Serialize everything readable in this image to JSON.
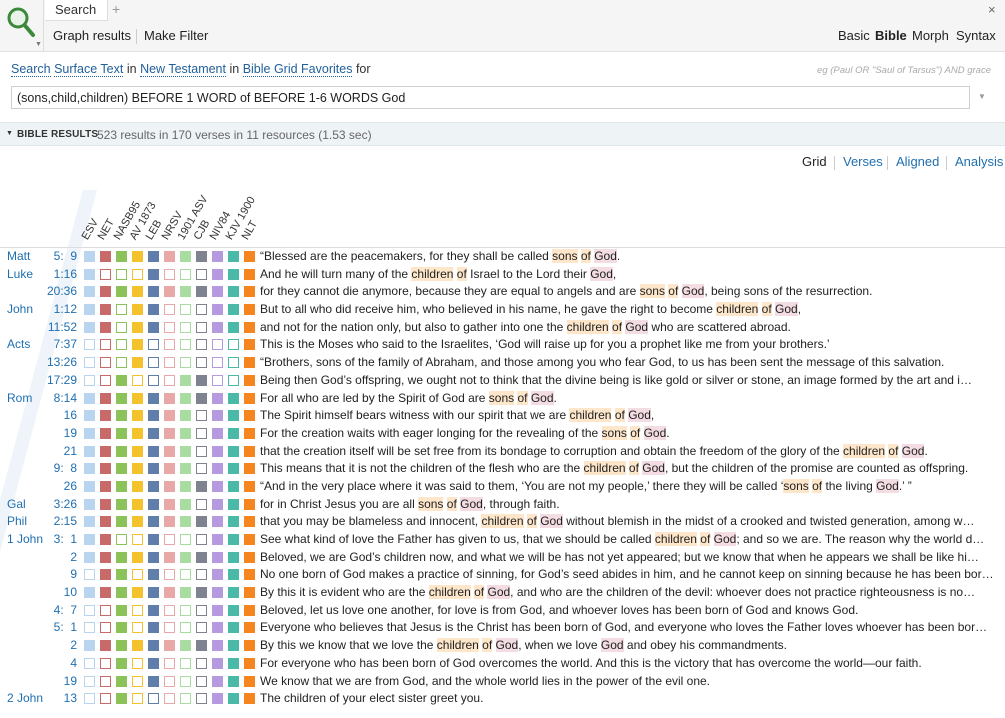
{
  "app": {
    "tab_label": "Search",
    "tab_add": "+",
    "tab_close": "×",
    "toolbar": {
      "graph_results": "Graph results",
      "make_filter": "Make Filter"
    },
    "modes": {
      "basic": "Basic",
      "bible": "Bible",
      "morph": "Morph",
      "syntax": "Syntax"
    },
    "icons": {
      "search": "search-icon",
      "caret": "chevron-down-icon"
    }
  },
  "search": {
    "desc_prefix": "Search",
    "desc_scope": "Surface Text",
    "desc_in1": "in",
    "desc_testament": "New Testament",
    "desc_in2": "in",
    "desc_collection": "Bible Grid Favorites",
    "desc_for": "for",
    "example": "eg (Paul OR \"Saul of Tarsus\") AND grace",
    "query": "(sons,child,children) BEFORE 1 WORD of BEFORE 1-6 WORDS God"
  },
  "results": {
    "title": "BIBLE RESULTS",
    "summary": "523 results in 170 verses in 11 resources (1.53 sec)"
  },
  "views": {
    "grid": "Grid",
    "verses": "Verses",
    "aligned": "Aligned",
    "analysis": "Analysis"
  },
  "columns": [
    {
      "label": "ESV",
      "color": "#b9d4ee"
    },
    {
      "label": "NET",
      "color": "#c96a6a"
    },
    {
      "label": "NASB95",
      "color": "#8cc25a"
    },
    {
      "label": "AV 1873",
      "color": "#f3c22c"
    },
    {
      "label": "LEB",
      "color": "#5f7ea9"
    },
    {
      "label": "NRSV",
      "color": "#e9a8a8"
    },
    {
      "label": "1901 ASV",
      "color": "#a8dca0"
    },
    {
      "label": "CJB",
      "color": "#7f8390"
    },
    {
      "label": "NIV84",
      "color": "#b69ae0"
    },
    {
      "label": "KJV 1900",
      "color": "#4ab9a8"
    },
    {
      "label": "NLT",
      "color": "#f5851f"
    }
  ],
  "rows": [
    {
      "book": "Matt",
      "ref": "5:  9",
      "fill": [
        1,
        1,
        1,
        1,
        1,
        1,
        1,
        1,
        1,
        1,
        1
      ],
      "text": [
        [
          "“Blessed are the peacemakers, for they shall be called ",
          ""
        ],
        [
          "sons",
          "o"
        ],
        [
          " ",
          ""
        ],
        [
          "of",
          "o"
        ],
        [
          " ",
          ""
        ],
        [
          "God",
          "p"
        ],
        [
          ".",
          ""
        ]
      ]
    },
    {
      "book": "Luke",
      "ref": "1:16",
      "fill": [
        1,
        0,
        0,
        0,
        1,
        0,
        0,
        0,
        1,
        1,
        1
      ],
      "text": [
        [
          "And he will turn many of the ",
          ""
        ],
        [
          "children",
          "o"
        ],
        [
          " ",
          ""
        ],
        [
          "of",
          "o"
        ],
        [
          " Israel to the Lord their ",
          ""
        ],
        [
          "God",
          "p"
        ],
        [
          ",",
          ""
        ]
      ]
    },
    {
      "book": "",
      "ref": "20:36",
      "fill": [
        1,
        1,
        1,
        1,
        1,
        1,
        1,
        1,
        1,
        1,
        1
      ],
      "text": [
        [
          "for they cannot die anymore, because they are equal to angels and are ",
          ""
        ],
        [
          "sons",
          "o"
        ],
        [
          " ",
          ""
        ],
        [
          "of",
          "o"
        ],
        [
          " ",
          ""
        ],
        [
          "God",
          "p"
        ],
        [
          ", being sons of the resurrection.",
          ""
        ]
      ]
    },
    {
      "book": "John",
      "ref": "1:12",
      "fill": [
        1,
        1,
        0,
        1,
        1,
        0,
        0,
        0,
        1,
        1,
        1
      ],
      "text": [
        [
          "But to all who did receive him, who believed in his name, he gave the right to become ",
          ""
        ],
        [
          "children",
          "o"
        ],
        [
          " ",
          ""
        ],
        [
          "of",
          "o"
        ],
        [
          " ",
          ""
        ],
        [
          "God",
          "p"
        ],
        [
          ",",
          ""
        ]
      ]
    },
    {
      "book": "",
      "ref": "11:52",
      "fill": [
        1,
        1,
        0,
        1,
        1,
        0,
        0,
        0,
        1,
        1,
        1
      ],
      "text": [
        [
          "and not for the nation only, but also to gather into one the ",
          ""
        ],
        [
          "children",
          "o"
        ],
        [
          " ",
          ""
        ],
        [
          "of",
          "o"
        ],
        [
          " ",
          ""
        ],
        [
          "God",
          "p"
        ],
        [
          " who are scattered abroad.",
          ""
        ]
      ]
    },
    {
      "book": "Acts",
      "ref": "7:37",
      "fill": [
        0,
        0,
        0,
        1,
        0,
        0,
        0,
        0,
        0,
        0,
        1
      ],
      "text": [
        [
          "This is the Moses who said to the Israelites, ‘God will raise up for you a prophet like me from your brothers.’",
          ""
        ]
      ]
    },
    {
      "book": "",
      "ref": "13:26",
      "fill": [
        0,
        0,
        0,
        1,
        0,
        0,
        0,
        0,
        0,
        0,
        1
      ],
      "text": [
        [
          "“Brothers, sons of the family of Abraham, and those among you who fear God, to us has been sent the message of this salvation.",
          ""
        ]
      ]
    },
    {
      "book": "",
      "ref": "17:29",
      "fill": [
        0,
        0,
        1,
        0,
        0,
        0,
        1,
        1,
        0,
        0,
        1
      ],
      "text": [
        [
          "Being then God’s offspring, we ought not to think that the divine being is like gold or silver or stone, an image formed by the art and i…",
          ""
        ]
      ]
    },
    {
      "book": "Rom",
      "ref": "8:14",
      "fill": [
        1,
        1,
        1,
        1,
        1,
        1,
        1,
        1,
        1,
        1,
        1
      ],
      "text": [
        [
          "For all who are led by the Spirit of God are ",
          ""
        ],
        [
          "sons",
          "o"
        ],
        [
          " ",
          ""
        ],
        [
          "of",
          "o"
        ],
        [
          " ",
          ""
        ],
        [
          "God",
          "p"
        ],
        [
          ".",
          ""
        ]
      ]
    },
    {
      "book": "",
      "ref": "16",
      "fill": [
        1,
        1,
        1,
        1,
        1,
        1,
        1,
        0,
        1,
        1,
        1
      ],
      "text": [
        [
          "The Spirit himself bears witness with our spirit that we are ",
          ""
        ],
        [
          "children",
          "o"
        ],
        [
          " ",
          ""
        ],
        [
          "of",
          "o"
        ],
        [
          " ",
          ""
        ],
        [
          "God",
          "p"
        ],
        [
          ",",
          ""
        ]
      ]
    },
    {
      "book": "",
      "ref": "19",
      "fill": [
        1,
        1,
        1,
        1,
        1,
        1,
        1,
        0,
        1,
        1,
        1
      ],
      "text": [
        [
          "For the creation waits with eager longing for the revealing of the ",
          ""
        ],
        [
          "sons",
          "o"
        ],
        [
          " ",
          ""
        ],
        [
          "of",
          "o"
        ],
        [
          " ",
          ""
        ],
        [
          "God",
          "p"
        ],
        [
          ".",
          ""
        ]
      ]
    },
    {
      "book": "",
      "ref": "21",
      "fill": [
        1,
        1,
        1,
        1,
        1,
        1,
        1,
        0,
        1,
        1,
        1
      ],
      "text": [
        [
          "that the creation itself will be set free from its bondage to corruption and obtain the freedom of the glory of the ",
          ""
        ],
        [
          "children",
          "o"
        ],
        [
          " ",
          ""
        ],
        [
          "of",
          "o"
        ],
        [
          " ",
          ""
        ],
        [
          "God",
          "p"
        ],
        [
          ".",
          ""
        ]
      ]
    },
    {
      "book": "",
      "ref": "9:  8",
      "fill": [
        1,
        1,
        1,
        1,
        1,
        1,
        1,
        0,
        1,
        1,
        1
      ],
      "text": [
        [
          "This means that it is not the children of the flesh who are the ",
          ""
        ],
        [
          "children",
          "o"
        ],
        [
          " ",
          ""
        ],
        [
          "of",
          "o"
        ],
        [
          " ",
          ""
        ],
        [
          "God",
          "p"
        ],
        [
          ", but the children of the promise are counted as offspring.",
          ""
        ]
      ]
    },
    {
      "book": "",
      "ref": "26",
      "fill": [
        1,
        1,
        1,
        1,
        1,
        1,
        1,
        1,
        1,
        1,
        1
      ],
      "text": [
        [
          "“And in the very place where it was said to them, ‘You are not my people,’ there they will be called ‘",
          ""
        ],
        [
          "sons",
          "o"
        ],
        [
          " ",
          ""
        ],
        [
          "of",
          "o"
        ],
        [
          " the living ",
          ""
        ],
        [
          "God",
          "p"
        ],
        [
          ".’ ”",
          ""
        ]
      ]
    },
    {
      "book": "Gal",
      "ref": "3:26",
      "fill": [
        1,
        1,
        1,
        1,
        1,
        1,
        1,
        0,
        1,
        1,
        1
      ],
      "text": [
        [
          "for in Christ Jesus you are all ",
          ""
        ],
        [
          "sons",
          "o"
        ],
        [
          " ",
          ""
        ],
        [
          "of",
          "o"
        ],
        [
          " ",
          ""
        ],
        [
          "God",
          "p"
        ],
        [
          ", through faith.",
          ""
        ]
      ]
    },
    {
      "book": "Phil",
      "ref": "2:15",
      "fill": [
        1,
        1,
        1,
        1,
        1,
        1,
        1,
        1,
        1,
        1,
        1
      ],
      "text": [
        [
          "that you may be blameless and innocent, ",
          ""
        ],
        [
          "children",
          "o"
        ],
        [
          " ",
          ""
        ],
        [
          "of",
          "o"
        ],
        [
          " ",
          ""
        ],
        [
          "God",
          "p"
        ],
        [
          " without blemish in the midst of a crooked and twisted generation, among w…",
          ""
        ]
      ]
    },
    {
      "book": "1 John",
      "ref": "3:  1",
      "fill": [
        1,
        1,
        0,
        0,
        1,
        0,
        0,
        0,
        1,
        1,
        1
      ],
      "text": [
        [
          "See what kind of love the Father has given to us, that we should be called ",
          ""
        ],
        [
          "children",
          "o"
        ],
        [
          " ",
          ""
        ],
        [
          "of",
          "o"
        ],
        [
          " ",
          ""
        ],
        [
          "God",
          "p"
        ],
        [
          "; and so we are. The reason why the world d…",
          ""
        ]
      ]
    },
    {
      "book": "",
      "ref": "2",
      "fill": [
        1,
        1,
        1,
        1,
        1,
        1,
        1,
        1,
        1,
        1,
        1
      ],
      "text": [
        [
          "Beloved, we are God’s children now, and what we will be has not yet appeared; but we know that when he appears we shall be like hi…",
          ""
        ]
      ]
    },
    {
      "book": "",
      "ref": "9",
      "fill": [
        0,
        1,
        1,
        0,
        1,
        0,
        0,
        0,
        1,
        1,
        1
      ],
      "text": [
        [
          "No one born of God makes a practice of sinning, for God’s seed abides in him, and he cannot keep on sinning because he has been bor…",
          ""
        ]
      ]
    },
    {
      "book": "",
      "ref": "10",
      "fill": [
        1,
        1,
        1,
        1,
        1,
        1,
        1,
        1,
        1,
        1,
        1
      ],
      "text": [
        [
          "By this it is evident who are the ",
          ""
        ],
        [
          "children",
          "o"
        ],
        [
          " ",
          ""
        ],
        [
          "of",
          "o"
        ],
        [
          " ",
          ""
        ],
        [
          "God",
          "p"
        ],
        [
          ", and who are the children of the devil: whoever does not practice righteousness is no…",
          ""
        ]
      ]
    },
    {
      "book": "",
      "ref": "4:  7",
      "fill": [
        0,
        0,
        1,
        0,
        1,
        0,
        0,
        0,
        1,
        1,
        1
      ],
      "text": [
        [
          "Beloved, let us love one another, for love is from God, and whoever loves has been born of God and knows God.",
          ""
        ]
      ]
    },
    {
      "book": "",
      "ref": "5:  1",
      "fill": [
        0,
        0,
        1,
        0,
        1,
        0,
        0,
        0,
        1,
        1,
        1
      ],
      "text": [
        [
          "Everyone who believes that Jesus is the Christ has been born of God, and everyone who loves the Father loves whoever has been bor…",
          ""
        ]
      ]
    },
    {
      "book": "",
      "ref": "2",
      "fill": [
        1,
        1,
        1,
        1,
        1,
        1,
        1,
        1,
        1,
        1,
        1
      ],
      "text": [
        [
          "By this we know that we love the ",
          ""
        ],
        [
          "children",
          "o"
        ],
        [
          " ",
          ""
        ],
        [
          "of",
          "o"
        ],
        [
          " ",
          ""
        ],
        [
          "God",
          "p"
        ],
        [
          ", when we love ",
          ""
        ],
        [
          "God",
          "p"
        ],
        [
          " and obey his commandments.",
          ""
        ]
      ]
    },
    {
      "book": "",
      "ref": "4",
      "fill": [
        0,
        0,
        1,
        0,
        1,
        0,
        0,
        0,
        1,
        1,
        1
      ],
      "text": [
        [
          "For everyone who has been born of God overcomes the world. And this is the victory that has overcome the world—our faith.",
          ""
        ]
      ]
    },
    {
      "book": "",
      "ref": "19",
      "fill": [
        0,
        0,
        1,
        0,
        1,
        0,
        0,
        0,
        1,
        1,
        1
      ],
      "text": [
        [
          "We know that we are from God, and the whole world lies in the power of the evil one.",
          ""
        ]
      ]
    },
    {
      "book": "2 John",
      "ref": "13",
      "fill": [
        0,
        0,
        1,
        0,
        0,
        0,
        0,
        0,
        1,
        1,
        1
      ],
      "text": [
        [
          "The children of your elect sister greet you.",
          ""
        ]
      ]
    }
  ]
}
